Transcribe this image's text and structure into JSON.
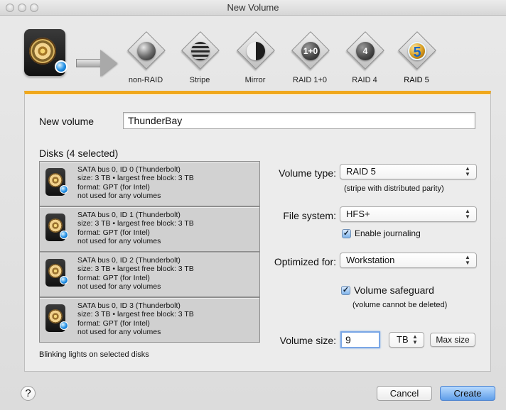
{
  "window": {
    "title": "New Volume"
  },
  "raid_options": [
    {
      "label": "non-RAID",
      "icon": "non-raid-icon",
      "selected": false
    },
    {
      "label": "Stripe",
      "icon": "stripe-icon",
      "selected": false
    },
    {
      "label": "Mirror",
      "icon": "mirror-icon",
      "selected": false
    },
    {
      "label": "RAID 1+0",
      "icon": "raid-10-icon",
      "icon_text": "1+0",
      "selected": false
    },
    {
      "label": "RAID 4",
      "icon": "raid-4-icon",
      "icon_text": "4",
      "selected": false
    },
    {
      "label": "RAID 5",
      "icon": "raid-5-icon",
      "icon_text": "5",
      "selected": true
    }
  ],
  "form": {
    "new_volume_label": "New volume",
    "new_volume_value": "ThunderBay",
    "disks_title": "Disks (4 selected)",
    "blinking_lights": "Blinking lights on selected disks",
    "volume_type_label": "Volume type:",
    "volume_type_value": "RAID 5",
    "volume_type_hint": "(stripe with distributed parity)",
    "file_system_label": "File system:",
    "file_system_value": "HFS+",
    "enable_journaling": "Enable journaling",
    "optimized_for_label": "Optimized for:",
    "optimized_for_value": "Workstation",
    "volume_safeguard": "Volume safeguard",
    "volume_safeguard_hint": "(volume cannot be deleted)",
    "volume_size_label": "Volume size:",
    "volume_size_value": "9",
    "volume_size_unit": "TB",
    "max_size_button": "Max size"
  },
  "disks": [
    {
      "name": "SATA bus 0, ID 0 (Thunderbolt)",
      "size": "size: 3 TB • largest free block: 3 TB",
      "format": "format: GPT (for Intel)",
      "usage": "not used for any volumes"
    },
    {
      "name": "SATA bus 0, ID 1 (Thunderbolt)",
      "size": "size: 3 TB • largest free block: 3 TB",
      "format": "format: GPT (for Intel)",
      "usage": "not used for any volumes"
    },
    {
      "name": "SATA bus 0, ID 2 (Thunderbolt)",
      "size": "size: 3 TB • largest free block: 3 TB",
      "format": "format: GPT (for Intel)",
      "usage": "not used for any volumes"
    },
    {
      "name": "SATA bus 0, ID 3 (Thunderbolt)",
      "size": "size: 3 TB • largest free block: 3 TB",
      "format": "format: GPT (for Intel)",
      "usage": "not used for any volumes"
    }
  ],
  "footer": {
    "help": "?",
    "cancel": "Cancel",
    "create": "Create"
  },
  "colors": {
    "accent": "#f0a81c",
    "create_button": "#5f9ee9",
    "focus_ring": "#7aa7e6"
  }
}
